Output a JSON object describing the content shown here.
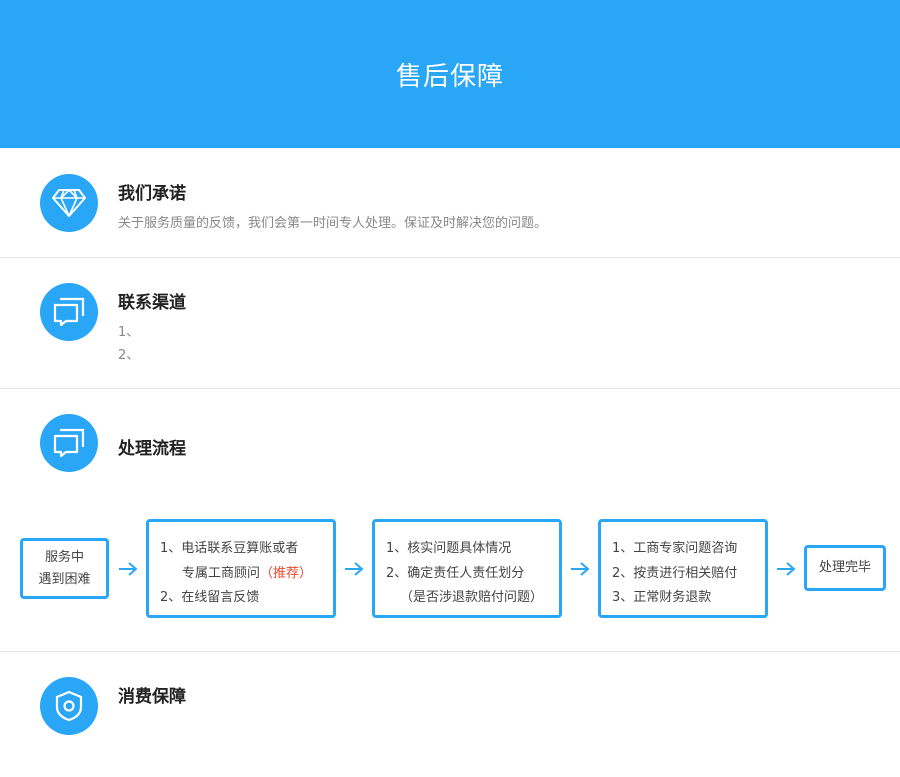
{
  "header": {
    "title": "售后保障"
  },
  "promise": {
    "title": "我们承诺",
    "desc": "关于服务质量的反馈，我们会第一时间专人处理。保证及时解决您的问题。"
  },
  "contact": {
    "title": "联系渠道",
    "lines": [
      "1、",
      "2、"
    ]
  },
  "process": {
    "title": "处理流程",
    "start": {
      "line1": "服务中",
      "line2": "遇到困难"
    },
    "step1": {
      "l1": "1、电话联系豆算账或者",
      "l2a": "专属工商顾问",
      "l2b": "（推荐）",
      "l3": "2、在线留言反馈"
    },
    "step2": {
      "l1": "1、核实问题具体情况",
      "l2": "2、确定责任人责任划分",
      "l3": "（是否涉退款赔付问题）"
    },
    "step3": {
      "l1": "1、工商专家问题咨询",
      "l2": "2、按责进行相关赔付",
      "l3": "3、正常财务退款"
    },
    "end": {
      "label": "处理完毕"
    }
  },
  "consumer": {
    "title": "消费保障"
  },
  "colors": {
    "accent": "#2aa6f7",
    "highlight": "#e8492d"
  }
}
